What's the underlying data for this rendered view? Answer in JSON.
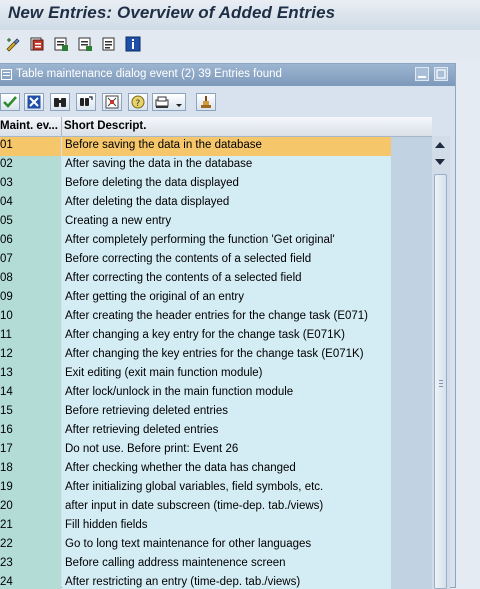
{
  "window": {
    "title": "New Entries: Overview of Added Entries"
  },
  "toolbar": {
    "icons": [
      "display-change-icon",
      "select-all-icon",
      "deselect-all-icon",
      "select-block-icon",
      "print-icon",
      "info-icon"
    ]
  },
  "dialog": {
    "title": "Table maintenance dialog event (2)   39 Entries found",
    "toolbar_icons": [
      "continue-check-icon",
      "cancel-icon",
      "find-icon",
      "find-next-icon",
      "filter-icon",
      "help-icon",
      "print-list-icon",
      "sort-icon"
    ]
  },
  "table": {
    "columns": [
      "Maint. ev...",
      "Short Descript."
    ],
    "selected_row_index": 0,
    "rows": [
      {
        "code": "01",
        "desc": "Before saving the data in the database"
      },
      {
        "code": "02",
        "desc": "After saving the data in the database"
      },
      {
        "code": "03",
        "desc": "Before deleting the data displayed"
      },
      {
        "code": "04",
        "desc": "After deleting the data displayed"
      },
      {
        "code": "05",
        "desc": "Creating a new entry"
      },
      {
        "code": "06",
        "desc": "After completely performing the function 'Get original'"
      },
      {
        "code": "07",
        "desc": "Before correcting the contents of a selected field"
      },
      {
        "code": "08",
        "desc": "After correcting the contents of a selected field"
      },
      {
        "code": "09",
        "desc": "After getting the original of an entry"
      },
      {
        "code": "10",
        "desc": "After creating the header entries for the change task (E071)"
      },
      {
        "code": "11",
        "desc": "After changing a key entry for the change task (E071K)"
      },
      {
        "code": "12",
        "desc": "After changing the key entries for the change task (E071K)"
      },
      {
        "code": "13",
        "desc": "Exit editing (exit main function module)"
      },
      {
        "code": "14",
        "desc": "After lock/unlock in the main function module"
      },
      {
        "code": "15",
        "desc": "Before retrieving deleted entries"
      },
      {
        "code": "16",
        "desc": "After retrieving deleted entries"
      },
      {
        "code": "17",
        "desc": "Do not use. Before print: Event 26"
      },
      {
        "code": "18",
        "desc": "After checking whether the data has changed"
      },
      {
        "code": "19",
        "desc": "After initializing global variables, field symbols, etc."
      },
      {
        "code": "20",
        "desc": "after input in date subscreen (time-dep. tab./views)"
      },
      {
        "code": "21",
        "desc": "Fill hidden fields"
      },
      {
        "code": "22",
        "desc": "Go to long text maintenance for other languages"
      },
      {
        "code": "23",
        "desc": "Before calling address maintenence screen"
      },
      {
        "code": "24",
        "desc": "After restricting an entry (time-dep. tab./views)"
      }
    ]
  },
  "colors": {
    "selected_row": "#f6c66b",
    "key_column": "#b3dcd7",
    "text_column": "#d4ecf4",
    "dialog_title": "#7d99bb"
  }
}
